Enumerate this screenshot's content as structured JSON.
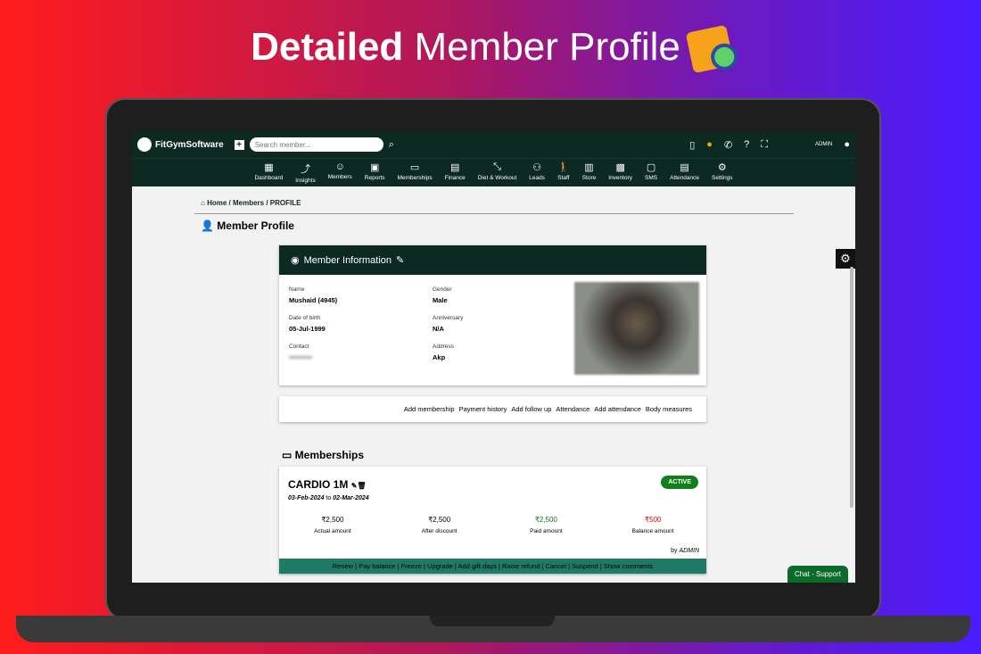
{
  "headline": {
    "bold": "Detailed",
    "rest": "Member Profile"
  },
  "app": {
    "name": "FitGymSoftware",
    "search_placeholder": "Search member...",
    "user": "ADMIN"
  },
  "nav": [
    {
      "icon": "▦",
      "label": "Dashboard"
    },
    {
      "icon": "⤴",
      "label": "Insights"
    },
    {
      "icon": "☺",
      "label": "Members"
    },
    {
      "icon": "▣",
      "label": "Reports"
    },
    {
      "icon": "▭",
      "label": "Memberships"
    },
    {
      "icon": "▤",
      "label": "Finance"
    },
    {
      "icon": "⤡",
      "label": "Diet & Workout"
    },
    {
      "icon": "⚇",
      "label": "Leads"
    },
    {
      "icon": "🚶",
      "label": "Staff"
    },
    {
      "icon": "▥",
      "label": "Store"
    },
    {
      "icon": "▩",
      "label": "Inventory"
    },
    {
      "icon": "▢",
      "label": "SMS"
    },
    {
      "icon": "▤",
      "label": "Attendance"
    },
    {
      "icon": "⚙",
      "label": "Settings"
    }
  ],
  "breadcrumb": {
    "home": "Home",
    "members": "Members",
    "current": "PROFILE"
  },
  "title": "Member Profile",
  "info": {
    "header": "Member Information",
    "name_label": "Name",
    "name": "Mushaid (4945)",
    "gender_label": "Gender",
    "gender": "Male",
    "dob_label": "Date of birth",
    "dob": "05-Jul-1999",
    "anniv_label": "Anniversary",
    "anniv": "N/A",
    "contact_label": "Contact",
    "contact": "••••••••••",
    "address_label": "Address",
    "address": "Akp"
  },
  "actions": [
    "Add membership",
    "Payment history",
    "Add follow up",
    "Attendance",
    "Add attendance",
    "Body measures"
  ],
  "memberships_title": "Memberships",
  "membership": {
    "plan": "CARDIO 1M",
    "status": "ACTIVE",
    "start": "03-Feb-2024",
    "to": "to",
    "end": "02-Mar-2024",
    "amounts": [
      {
        "value": "₹2,500",
        "label": "Actual amount",
        "color": "#000"
      },
      {
        "value": "₹2,500",
        "label": "After discount",
        "color": "#000"
      },
      {
        "value": "₹2,500",
        "label": "Paid amount",
        "color": "#0a7a10"
      },
      {
        "value": "₹500",
        "label": "Balance amount",
        "color": "#e00000"
      }
    ],
    "by": "by",
    "by_user": "ADMIN",
    "footer": "Renew | Pay balance | Freeze | Upgrade | Add gift days | Raise refund | Cancel | Suspend | Show comments"
  },
  "chat": "Chat - Support"
}
